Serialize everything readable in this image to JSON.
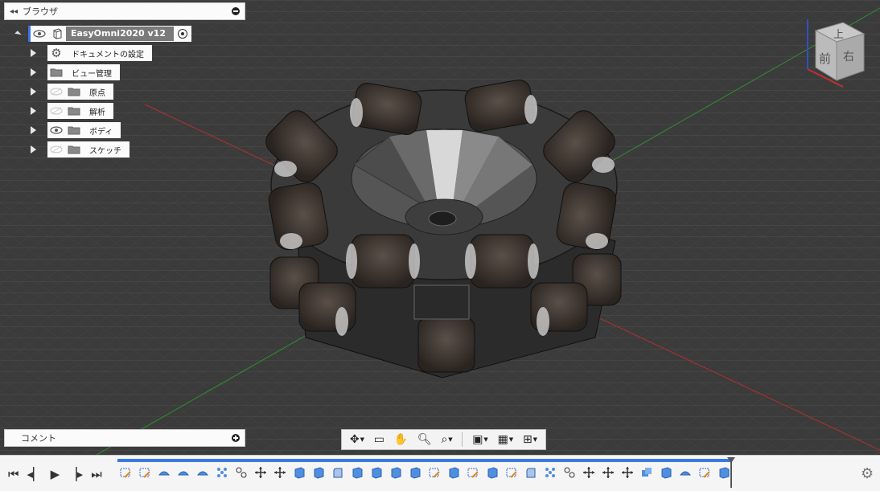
{
  "browser": {
    "collapse_icon": "double-chevron-left-icon",
    "title": "ブラウザ",
    "root": {
      "name": "EasyOmni2020 v12"
    },
    "items": [
      {
        "label": "ドキュメントの設定",
        "icon": "gear-icon",
        "visible": null
      },
      {
        "label": "ビュー管理",
        "icon": "folder-icon",
        "visible": null
      },
      {
        "label": "原点",
        "icon": "folder-icon",
        "visible": false
      },
      {
        "label": "解析",
        "icon": "folder-icon",
        "visible": false
      },
      {
        "label": "ボディ",
        "icon": "folder-icon",
        "visible": true
      },
      {
        "label": "スケッチ",
        "icon": "folder-icon",
        "visible": false
      }
    ]
  },
  "comment": {
    "title": "コメント"
  },
  "viewcube": {
    "top": "上",
    "front": "前",
    "right": "右"
  },
  "colors": {
    "accent": "#3a7be0",
    "viewport": "#3a3a3a",
    "axis_x": "#b03030",
    "axis_y": "#2f8f2f",
    "axis_z": "#3050c0"
  },
  "navbar": {
    "tools": [
      "orbit-icon",
      "look-at-icon",
      "pan-icon",
      "zoom-icon",
      "fit-icon",
      "display-settings-icon",
      "grid-icon",
      "viewports-icon"
    ]
  },
  "timeline": {
    "controls": [
      "go-to-start-icon",
      "step-back-icon",
      "play-icon",
      "step-forward-icon",
      "go-to-end-icon"
    ],
    "features": [
      "sketch",
      "sketch",
      "extrude",
      "extrude",
      "extrude",
      "pattern",
      "joint",
      "move",
      "move",
      "body",
      "body",
      "fillet",
      "body",
      "body",
      "body",
      "body",
      "sketch",
      "body",
      "sketch",
      "body",
      "sketch",
      "fillet",
      "pattern",
      "joint",
      "move",
      "move",
      "move",
      "combine",
      "body",
      "extrude",
      "sketch",
      "body"
    ]
  }
}
